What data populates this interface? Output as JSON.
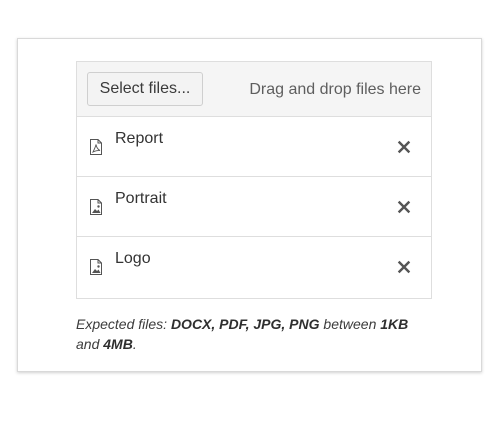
{
  "upload": {
    "select_button_label": "Select files...",
    "drop_hint": "Drag and drop files here",
    "files": [
      {
        "name": "Report",
        "icon": "pdf-file-icon"
      },
      {
        "name": "Portrait",
        "icon": "image-file-icon"
      },
      {
        "name": "Logo",
        "icon": "image-file-icon"
      }
    ],
    "remove_icon": "close-icon"
  },
  "note": {
    "prefix": "Expected files: ",
    "types": "DOCX, PDF, JPG, PNG",
    "between": " between ",
    "min_size": "1KB",
    "and": " and ",
    "max_size": "4MB",
    "suffix": "."
  },
  "colors": {
    "border": "#dedede",
    "dropzone_bg": "#f5f5f5",
    "text": "#333333",
    "icon": "#555555"
  }
}
